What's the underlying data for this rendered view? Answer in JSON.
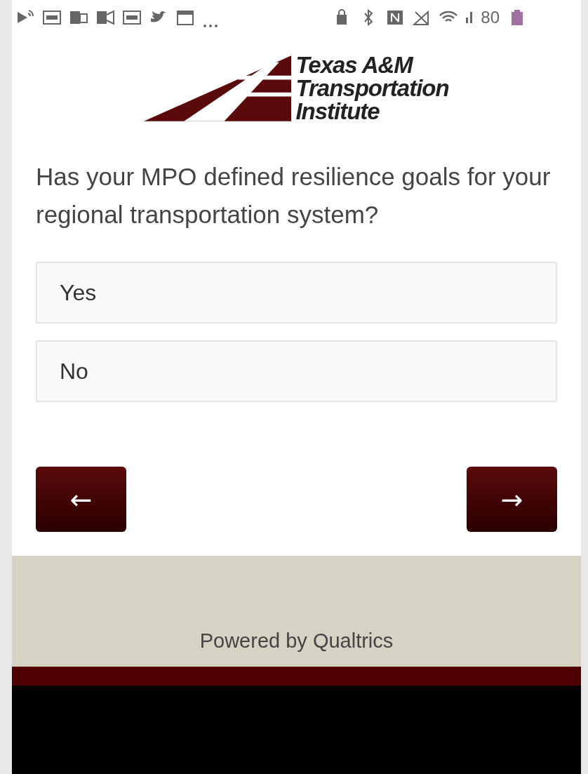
{
  "status_bar": {
    "battery": "80"
  },
  "logo": {
    "line_1": "Texas A&M",
    "line_2": "Transportation",
    "line_3": "Institute"
  },
  "question": {
    "text": "Has your MPO defined resilience goals for your regional transportation system?"
  },
  "choices": [
    {
      "label": "Yes",
      "selected": false
    },
    {
      "label": "No",
      "selected": false
    }
  ],
  "navigation": {
    "back": "←",
    "next": "→"
  },
  "footer": {
    "text": "Powered by Qualtrics"
  }
}
